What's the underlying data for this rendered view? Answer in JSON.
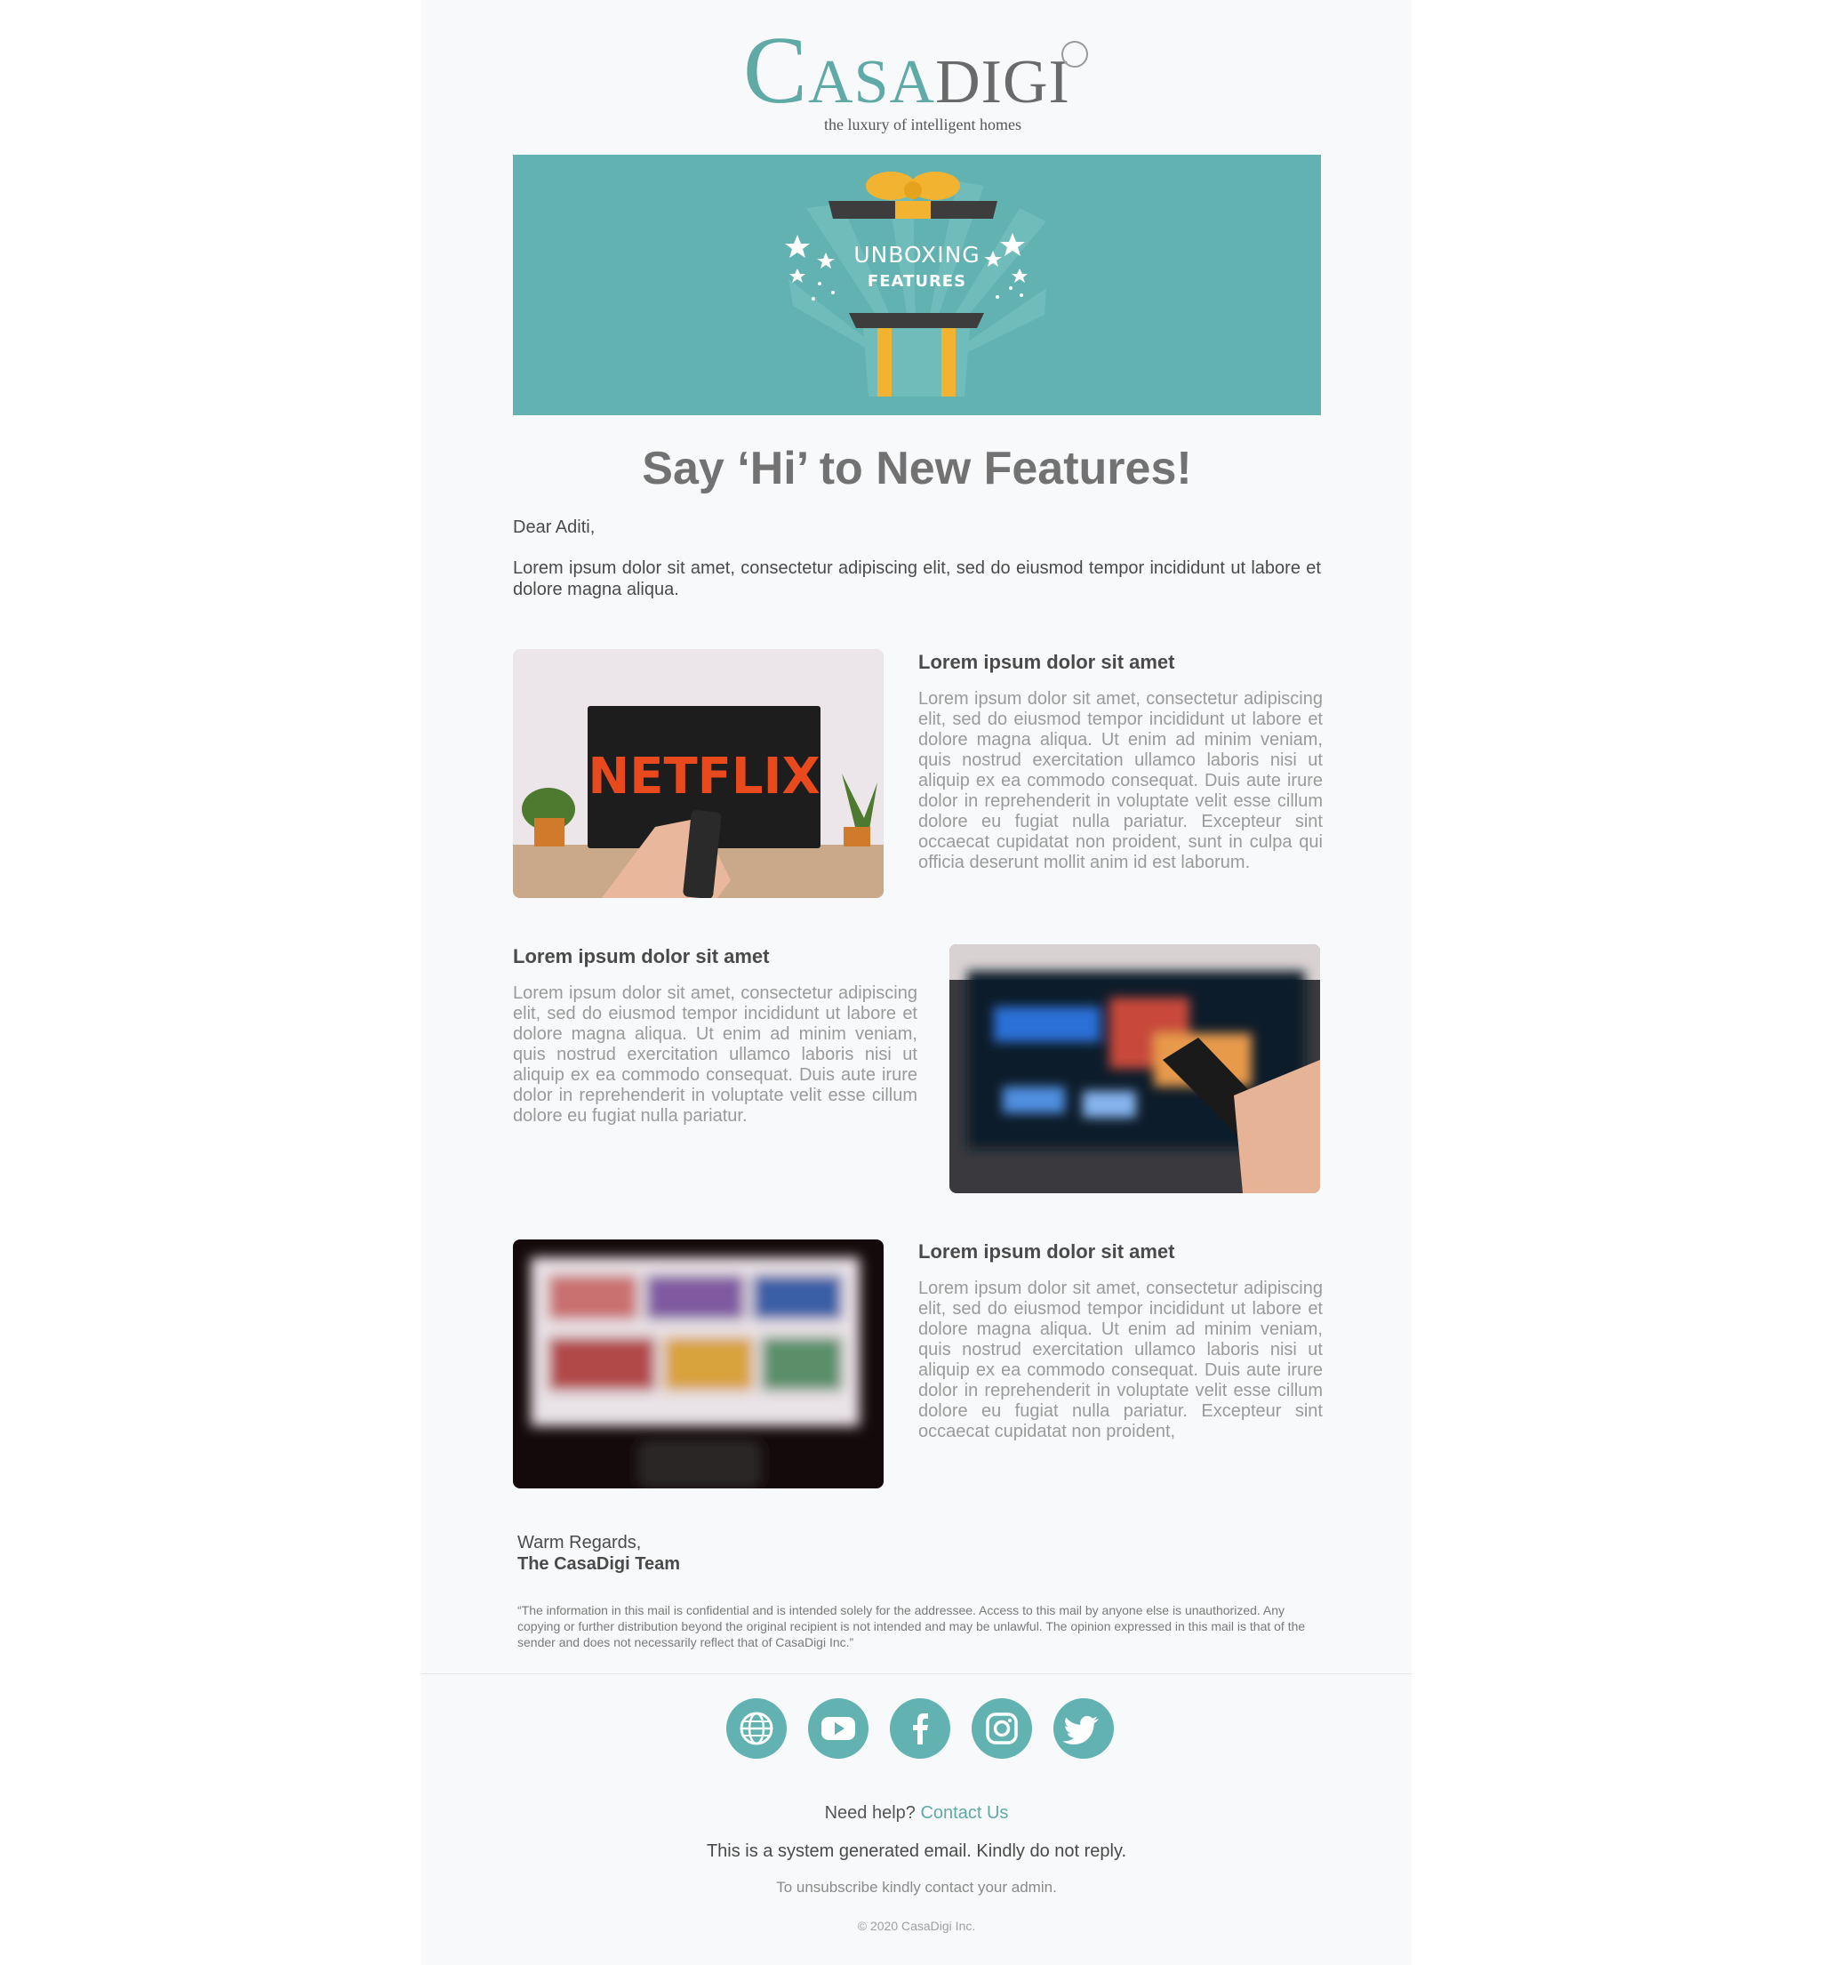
{
  "brand": {
    "logo_text": "CASADIGI",
    "tagline": "the luxury of intelligent homes"
  },
  "banner": {
    "line1": "UNBOXING",
    "line2": "FEATURES"
  },
  "headline": "Say ‘Hi’ to New Features!",
  "greeting": "Dear Aditi,",
  "intro": "Lorem ipsum dolor sit amet, consectetur adipiscing elit, sed do eiusmod tempor incididunt ut labore et dolore magna aliqua.",
  "features": [
    {
      "title": "Lorem ipsum dolor sit amet",
      "body": "Lorem ipsum dolor sit amet, consectetur adipiscing elit, sed do eiusmod tempor incididunt ut labore et dolore magna aliqua. Ut enim ad minim veniam, quis nostrud exercitation ullamco laboris nisi ut aliquip ex ea commodo consequat. Duis aute irure dolor in reprehenderit in voluptate velit esse cillum dolore eu fugiat nulla pariatur. Excepteur sint occaecat cupidatat non proident, sunt in culpa qui officia deserunt mollit anim id est laborum.",
      "image_text": "NETFLIX"
    },
    {
      "title": "Lorem ipsum dolor sit amet",
      "body": "Lorem ipsum dolor sit amet, consectetur adipiscing elit, sed do eiusmod tempor incididunt ut labore et dolore magna aliqua. Ut enim ad minim veniam, quis nostrud exercitation ullamco laboris nisi ut aliquip ex ea commodo consequat. Duis aute irure dolor in reprehenderit in voluptate velit esse cillum dolore eu fugiat nulla pariatur."
    },
    {
      "title": "Lorem ipsum dolor sit amet",
      "body": "Lorem ipsum dolor sit amet, consectetur adipiscing elit, sed do eiusmod tempor incididunt ut labore et dolore magna aliqua. Ut enim ad minim veniam, quis nostrud exercitation ullamco laboris nisi ut aliquip ex ea commodo consequat. Duis aute irure dolor in reprehenderit in voluptate velit esse cillum dolore eu fugiat nulla pariatur. Excepteur sint occaecat cupidatat non proident,"
    }
  ],
  "signoff": {
    "regards": "Warm Regards,",
    "team": "The CasaDigi Team"
  },
  "disclaimer": "“The information in this mail is confidential and is intended solely for the addressee. Access to this mail by anyone else is unauthorized. Any copying or further distribution beyond the original recipient is not intended and may be unlawful. The opinion expressed in this mail is that of the sender and does not necessarily reflect that of CasaDigi Inc.”",
  "social": [
    {
      "icon": "globe-icon"
    },
    {
      "icon": "youtube-icon"
    },
    {
      "icon": "facebook-icon"
    },
    {
      "icon": "instagram-icon"
    },
    {
      "icon": "twitter-icon"
    }
  ],
  "footer": {
    "help_prefix": "Need help?",
    "contact_link": "Contact Us",
    "system_msg": "This is a system generated email. Kindly do not reply.",
    "unsubscribe": "To unsubscribe kindly contact your admin.",
    "copyright": "© 2020 CasaDigi Inc."
  },
  "colors": {
    "accent": "#62b2b1",
    "heading": "#727272",
    "body_text": "#4a4a4a",
    "muted_text": "#9a9a9a"
  }
}
